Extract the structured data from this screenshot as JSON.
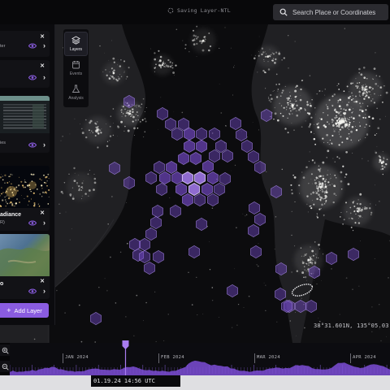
{
  "header": {
    "status": "Saving Layer-NTL",
    "search_placeholder": "Search Place or Coordinates"
  },
  "layers": [
    {
      "name": "",
      "subtitle": "ter",
      "visible": true,
      "thumb": "none"
    },
    {
      "name": "",
      "subtitle": "",
      "visible": true,
      "thumb": "none"
    },
    {
      "name": "",
      "subtitle": "ies",
      "visible": true,
      "thumb": "table"
    },
    {
      "name": "adiance",
      "subtitle": "R)",
      "visible": true,
      "thumb": "night-lights"
    },
    {
      "name": "o",
      "subtitle": "",
      "visible": true,
      "thumb": "satellite"
    }
  ],
  "add_layer_label": "Add Layer",
  "tools": [
    {
      "label": "Layers",
      "icon": "layers-icon",
      "active": true
    },
    {
      "label": "Events",
      "icon": "calendar-icon",
      "active": false
    },
    {
      "label": "Analysis",
      "icon": "flask-icon",
      "active": false
    }
  ],
  "map": {
    "coordinates": "38°31.601N, 135°05.03",
    "accent": "#8a5ce0"
  },
  "timeline": {
    "months": [
      "JAN 2024",
      "FEB 2024",
      "MAR 2024",
      "APR 2024"
    ],
    "timestamp": "01.19.24 14:56 UTC"
  },
  "colors": {
    "accent": "#8a5ce0",
    "hex_fill": "#7c4ed6",
    "panel": "#0b0b0e"
  }
}
